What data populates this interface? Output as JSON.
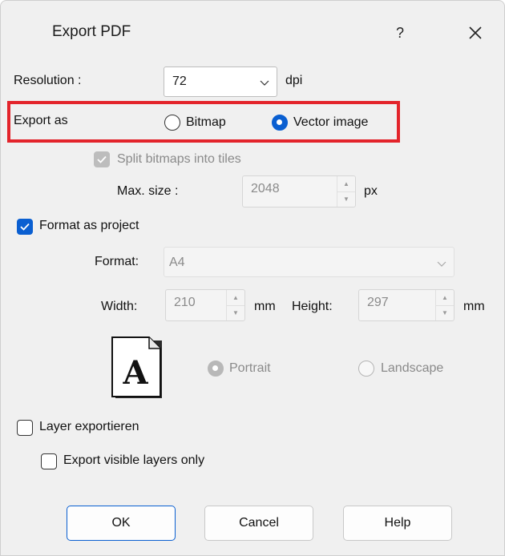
{
  "window": {
    "title": "Export PDF",
    "help_glyph": "?",
    "close_glyph": "✕"
  },
  "resolution": {
    "label": "Resolution :",
    "value": "72",
    "unit": "dpi"
  },
  "export_as": {
    "label": "Export as",
    "options": [
      {
        "label": "Bitmap",
        "selected": false
      },
      {
        "label": "Vector image",
        "selected": true
      }
    ],
    "highlight_color": "#e3242b"
  },
  "tiles": {
    "split_label": "Split bitmaps into tiles",
    "split_checked": true,
    "split_enabled": false,
    "max_size_label": "Max. size :",
    "max_size_value": "2048",
    "max_size_unit": "px"
  },
  "format_as_project": {
    "label": "Format as project",
    "checked": true,
    "format_label": "Format:",
    "format_value": "A4",
    "width_label": "Width:",
    "width_value": "210",
    "width_unit": "mm",
    "height_label": "Height:",
    "height_value": "297",
    "height_unit": "mm",
    "page_glyph": "A",
    "orientation": [
      {
        "label": "Portrait",
        "selected": true
      },
      {
        "label": "Landscape",
        "selected": false
      }
    ]
  },
  "layers": {
    "export_layers_label": "Layer exportieren",
    "export_layers_checked": false,
    "visible_only_label": "Export visible layers only",
    "visible_only_checked": false
  },
  "buttons": {
    "ok": "OK",
    "cancel": "Cancel",
    "help": "Help"
  },
  "colors": {
    "accent": "#0a5fd1",
    "dialog_bg": "#f0f0f0",
    "disabled_text": "#8a8a8a"
  }
}
